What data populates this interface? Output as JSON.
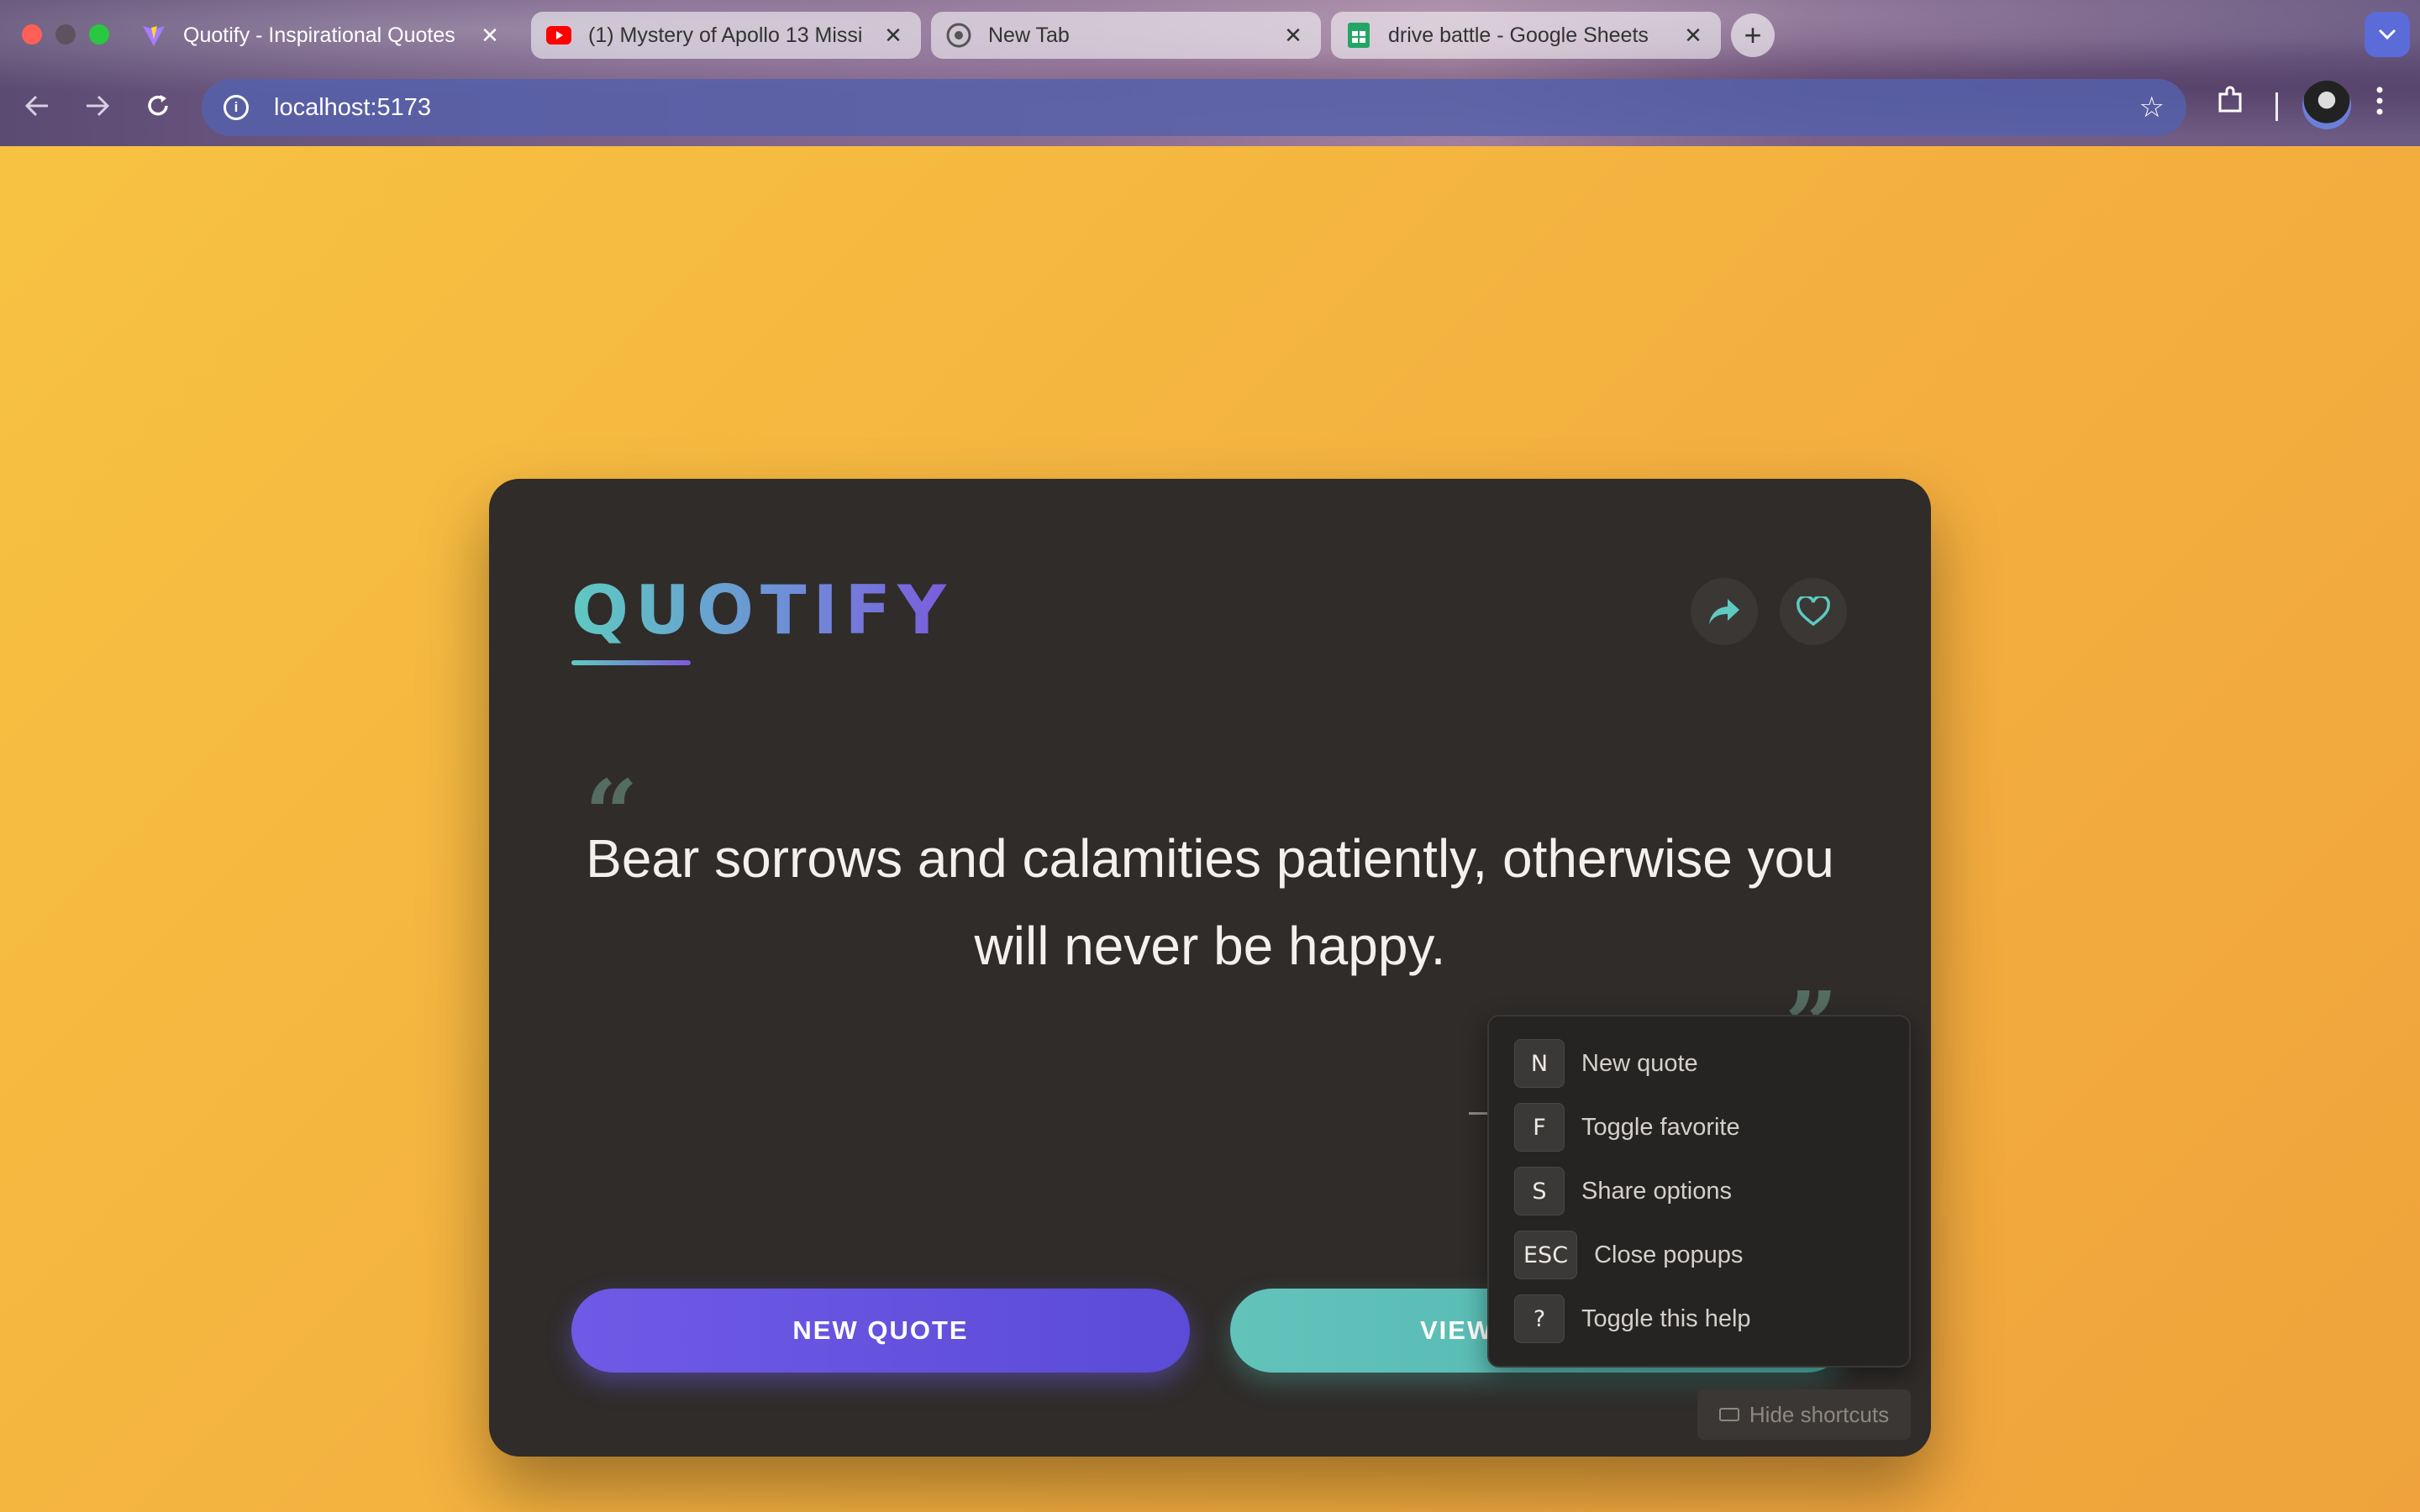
{
  "browser": {
    "tabs": [
      {
        "title": "Quotify - Inspirational Quotes",
        "icon": "vite-icon",
        "active": true
      },
      {
        "title": "(1) Mystery of Apollo 13 Missi",
        "icon": "youtube-icon",
        "active": false
      },
      {
        "title": "New Tab",
        "icon": "chrome-icon",
        "active": false
      },
      {
        "title": "drive battle - Google Sheets",
        "icon": "sheets-icon",
        "active": false
      }
    ],
    "close_glyph": "✕",
    "new_tab_glyph": "+",
    "url": "localhost:5173"
  },
  "app": {
    "logo": "QUOTIFY",
    "quote": "Bear sorrows and calamities patiently, otherwise you will never be happy.",
    "open_quote_glyph": "“",
    "close_quote_glyph": "”",
    "buttons": {
      "new_quote": "NEW QUOTE",
      "view": "VIEW"
    },
    "shortcuts": [
      {
        "key": "N",
        "label": "New quote"
      },
      {
        "key": "F",
        "label": "Toggle favorite"
      },
      {
        "key": "S",
        "label": "Share options"
      },
      {
        "key": "ESC",
        "label": "Close popups"
      },
      {
        "key": "?",
        "label": "Toggle this help"
      }
    ],
    "hide_shortcuts": "Hide shortcuts"
  },
  "colors": {
    "background": "#f4b13f",
    "card": "#2f2c2a",
    "primary_button": "#6f5ae6",
    "secondary_button": "#5fc2ba",
    "accent": "#5fc9c1"
  }
}
